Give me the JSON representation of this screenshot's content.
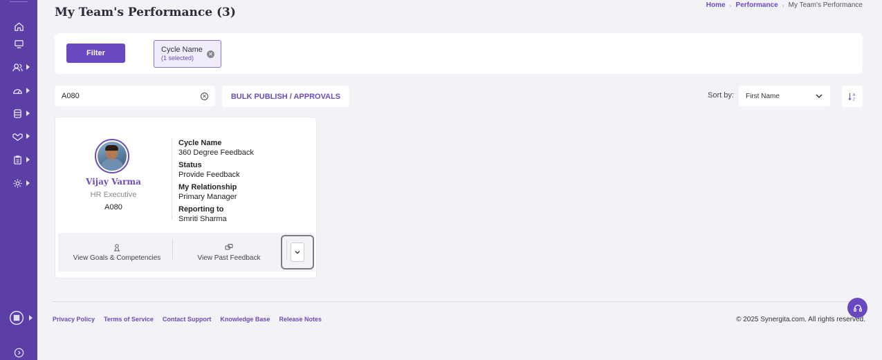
{
  "header": {
    "title": "My Team's Performance (3)",
    "breadcrumb": [
      "Home",
      "Performance",
      "My Team's Performance"
    ]
  },
  "sidebar": {
    "items": [
      {
        "icon": "home-icon"
      },
      {
        "icon": "monitor-icon"
      },
      {
        "icon": "users-icon"
      },
      {
        "icon": "gauge-icon"
      },
      {
        "icon": "database-icon"
      },
      {
        "icon": "handshake-icon"
      },
      {
        "icon": "clipboard-icon"
      },
      {
        "icon": "settings-icon"
      },
      {
        "icon": "apps-icon"
      },
      {
        "icon": "expand-icon"
      }
    ]
  },
  "filter": {
    "button_label": "Filter",
    "chip_label": "Cycle Name",
    "chip_sub": "(1 selected)"
  },
  "toolbar": {
    "search_value": "A080",
    "bulk_label": "BULK PUBLISH / APPROVALS",
    "sort_label": "Sort by:",
    "sort_value": "First Name"
  },
  "card": {
    "name": "Vijay Varma",
    "role": "HR Executive",
    "id": "A080",
    "fields": [
      {
        "label": "Cycle Name",
        "value": "360 Degree Feedback"
      },
      {
        "label": "Status",
        "value": "Provide Feedback"
      },
      {
        "label": "My Relationship",
        "value": "Primary Manager"
      },
      {
        "label": "Reporting to",
        "value": "Smriti Sharma"
      }
    ],
    "actions": {
      "goals": "View Goals & Competencies",
      "past": "View Past Feedback"
    }
  },
  "footer": {
    "links": [
      "Privacy Policy",
      "Terms of Service",
      "Contact Support",
      "Knowledge Base",
      "Release Notes"
    ],
    "copyright": "© 2025 Synergita.com. All rights reserved."
  },
  "colors": {
    "sidebar": "#5b3fa6",
    "accent": "#6a48c2",
    "link": "#6b4bbf"
  }
}
